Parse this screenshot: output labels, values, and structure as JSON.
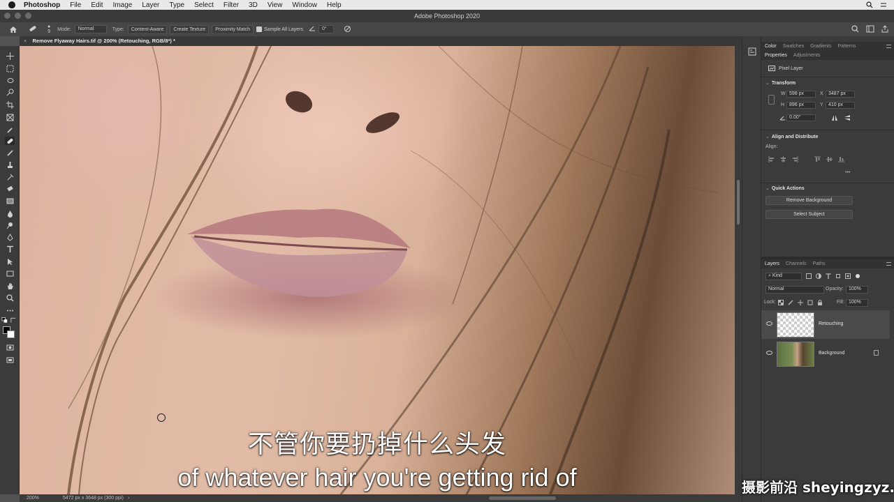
{
  "menubar": {
    "app": "Photoshop",
    "items": [
      "File",
      "Edit",
      "Image",
      "Layer",
      "Type",
      "Select",
      "Filter",
      "3D",
      "View",
      "Window",
      "Help"
    ]
  },
  "window": {
    "title": "Adobe Photoshop 2020"
  },
  "options_bar": {
    "brush_size": "9",
    "mode_label": "Mode:",
    "mode_value": "Normal",
    "type_label": "Type:",
    "type_buttons": [
      "Content-Aware",
      "Create Texture",
      "Proximity Match"
    ],
    "sample_all_layers": "Sample All Layers",
    "angle": "0°"
  },
  "document": {
    "tab_title": "Remove Flyaway Hairs.tif @ 200% (Retouching, RGB/8*) *",
    "close_glyph": "×"
  },
  "status_bar": {
    "zoom": "200%",
    "dimensions": "5472 px x 3648 px (300 ppi)",
    "arrow": "›"
  },
  "panels": {
    "top_tabs": [
      "Color",
      "Swatches",
      "Gradients",
      "Patterns"
    ],
    "second_tabs": [
      "Properties",
      "Adjustments"
    ],
    "layer_kind": "Pixel Layer",
    "transform": {
      "title": "Transform",
      "w_label": "W",
      "w": "598 px",
      "x_label": "X",
      "x": "3487 px",
      "h_label": "H",
      "h": "896 px",
      "y_label": "Y",
      "y": "410 px",
      "angle": "0.00°"
    },
    "align": {
      "title": "Align and Distribute",
      "label": "Align:",
      "more": "•••"
    },
    "quick_actions": {
      "title": "Quick Actions",
      "buttons": [
        "Remove Background",
        "Select Subject"
      ]
    },
    "layers_tabs": [
      "Layers",
      "Channels",
      "Paths"
    ],
    "kind_filter": "Kind",
    "blend_mode": "Normal",
    "opacity_label": "Opacity:",
    "opacity": "100%",
    "lock_label": "Lock:",
    "fill_label": "Fill:",
    "fill": "100%",
    "layers": [
      {
        "name": "Retouching",
        "selected": true
      },
      {
        "name": "Background",
        "selected": false
      }
    ]
  },
  "subtitles": {
    "chinese": "不管你要扔掉什么头发",
    "english": "of whatever hair you're getting rid of"
  },
  "watermark": "摄影前沿 sheyingzyz.com"
}
